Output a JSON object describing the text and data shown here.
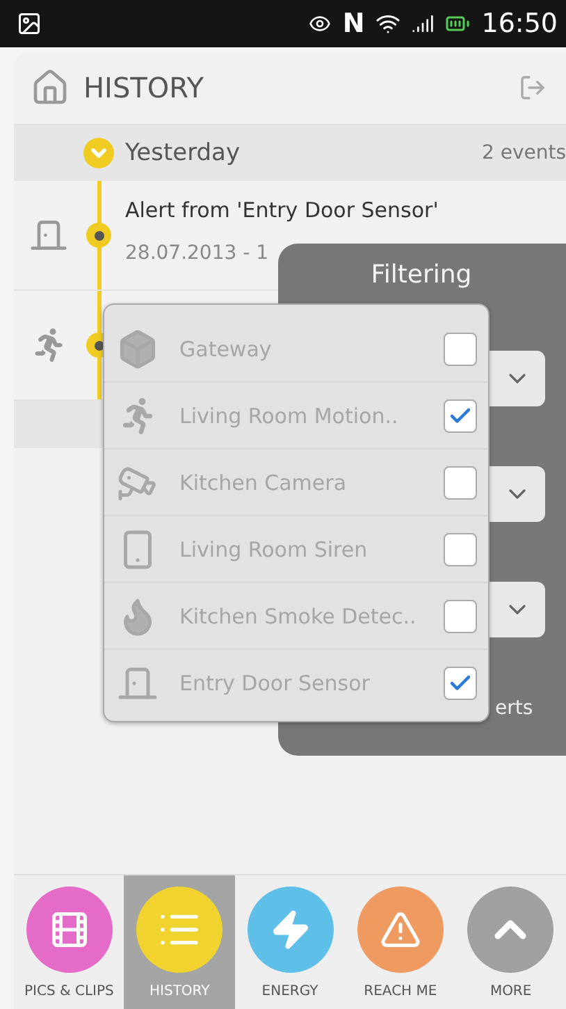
{
  "status_bar": {
    "n_label": "N",
    "time": "16:50"
  },
  "header": {
    "title": "HISTORY"
  },
  "days": [
    {
      "label": "Yesterday",
      "count": "2 events",
      "expanded": true
    }
  ],
  "events": [
    {
      "kind": "door",
      "title": "Alert from 'Entry Door Sensor'",
      "time": "28.07.2013 - 1"
    },
    {
      "kind": "motion"
    }
  ],
  "filter_panel": {
    "title": "Filtering",
    "footer": "erts"
  },
  "device_menu": [
    {
      "kind": "gateway",
      "label": "Gateway",
      "checked": false
    },
    {
      "kind": "motion",
      "label": "Living Room Motion..",
      "checked": true
    },
    {
      "kind": "camera",
      "label": "Kitchen Camera",
      "checked": false
    },
    {
      "kind": "siren",
      "label": "Living Room Siren",
      "checked": false
    },
    {
      "kind": "smoke",
      "label": "Kitchen Smoke Detec..",
      "checked": false
    },
    {
      "kind": "door",
      "label": "Entry Door Sensor",
      "checked": true
    }
  ],
  "nav": [
    {
      "kind": "film",
      "label": "PICS & CLIPS",
      "color": "#e46cc8",
      "selected": false
    },
    {
      "kind": "list",
      "label": "HISTORY",
      "color": "#f0d32e",
      "selected": true
    },
    {
      "kind": "bolt",
      "label": "ENERGY",
      "color": "#5ebfe8",
      "selected": false
    },
    {
      "kind": "alert",
      "label": "REACH ME",
      "color": "#ee9a60",
      "selected": false
    },
    {
      "kind": "up",
      "label": "MORE",
      "color": "#a0a0a0",
      "selected": false
    }
  ]
}
